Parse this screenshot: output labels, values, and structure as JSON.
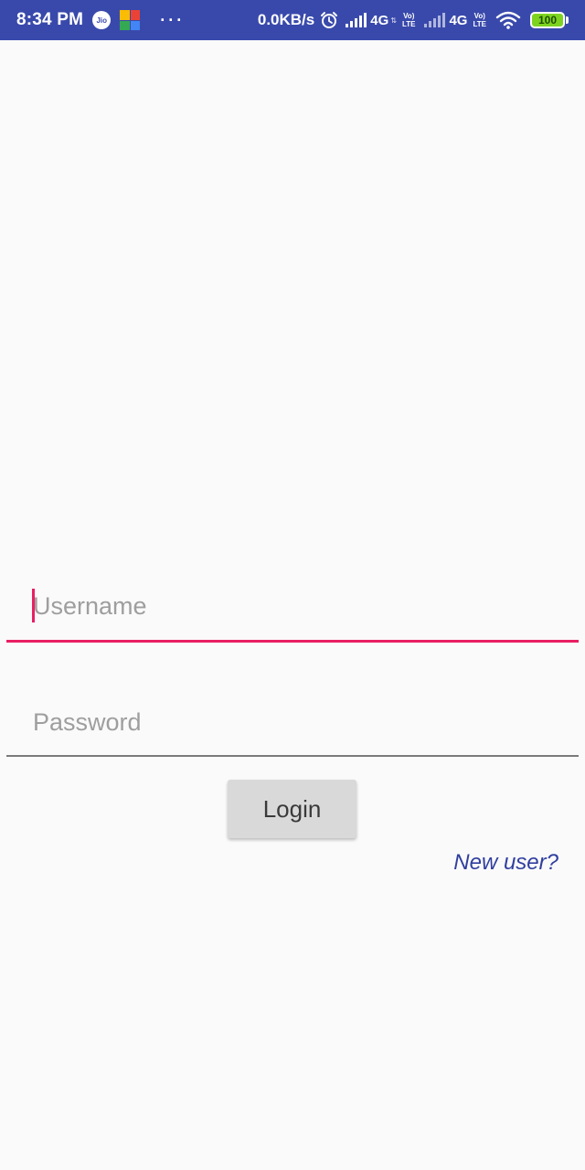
{
  "status_bar": {
    "time": "8:34 PM",
    "carrier_icon_label": "Jio",
    "more_notifications": "···",
    "network_speed": "0.0KB/s",
    "sim1_network": "4G",
    "sim2_network": "4G",
    "volte_top": "Vo)",
    "volte_bottom": "LTE",
    "battery_level": "100",
    "icons": [
      "jio-icon",
      "app-grid-icon",
      "alarm-icon",
      "signal-icon",
      "volte-icon",
      "wifi-icon",
      "battery-icon"
    ]
  },
  "login_form": {
    "username_placeholder": "Username",
    "password_placeholder": "Password",
    "login_label": "Login",
    "new_user_label": "New user?"
  },
  "colors": {
    "status_bar": "#3949ab",
    "accent": "#e91e63",
    "link": "#303f9f",
    "button_bg": "#d9d9d9",
    "battery": "#7ed321"
  }
}
